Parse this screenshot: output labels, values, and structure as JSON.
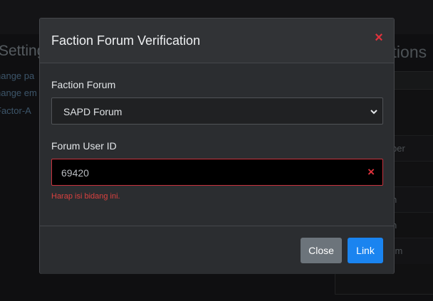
{
  "background": {
    "settings_title": "Settings",
    "links": [
      "hange pa",
      "hange em",
      "Factor-A"
    ],
    "associations_title": "Associations",
    "rows": [
      "ber",
      "",
      "n",
      "n",
      "num"
    ]
  },
  "modal": {
    "title": "Faction Forum Verification",
    "close_icon": "×",
    "faction_label": "Faction Forum",
    "faction_selected": "SAPD Forum",
    "user_id_label": "Forum User ID",
    "user_id_value": "69420",
    "error_icon": "×",
    "error_message": "Harap isi bidang ini.",
    "close_button": "Close",
    "link_button": "Link"
  },
  "colors": {
    "accent": "#1a84f0",
    "danger": "#e0323c",
    "secondary": "#6c747b"
  }
}
